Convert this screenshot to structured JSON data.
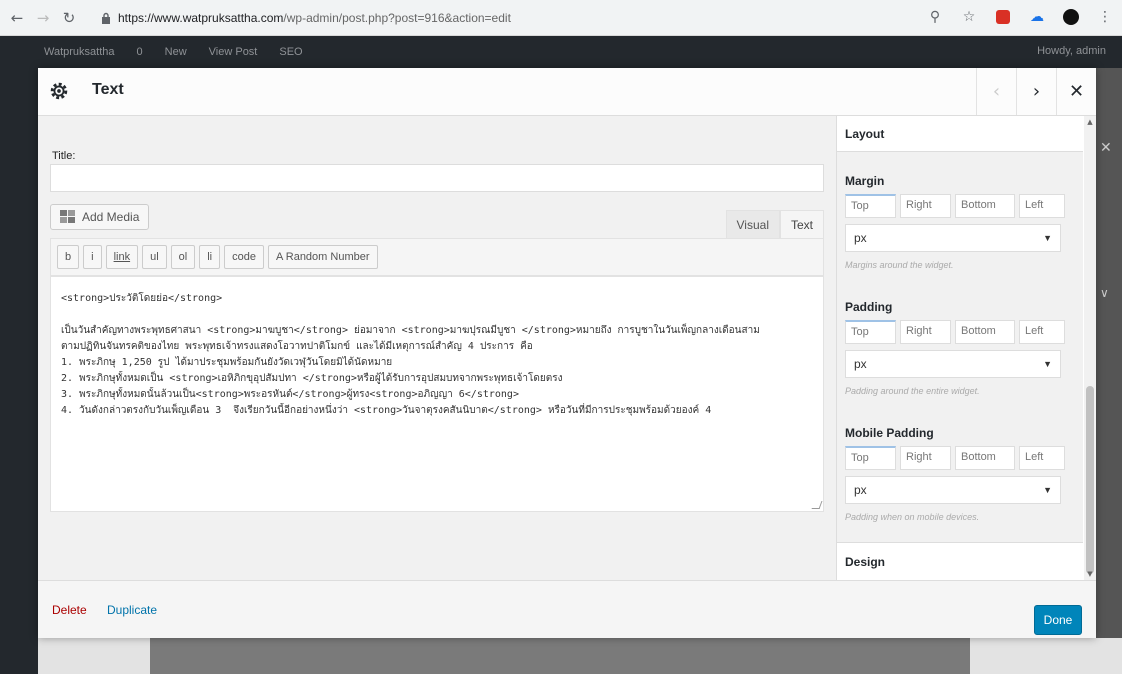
{
  "browser": {
    "url_host": "https://www.watpruksattha.com",
    "url_path": "/wp-admin/post.php?post=916&action=edit"
  },
  "adminbar": {
    "items": [
      "Watpruksattha",
      "0",
      "New",
      "View Post",
      "SEO"
    ],
    "howdy": "Howdy, admin"
  },
  "dialog": {
    "title": "Text",
    "title_label": "Title:",
    "title_value": "",
    "add_media": "Add Media",
    "tabs": [
      "Visual",
      "Text"
    ],
    "quicktags": [
      "b",
      "i",
      "link",
      "ul",
      "ol",
      "li",
      "code",
      "A Random Number"
    ],
    "editor_lines": [
      "<strong>ประวัติโดยย่อ</strong>",
      "",
      "เป็นวันสำคัญทางพระพุทธศาสนา <strong>มาฆบูชา</strong> ย่อมาจาก <strong>มาฆปุรณมีบูชา </strong>หมายถึง การบูชาในวันเพ็ญกลางเดือนสาม",
      "ตามปฏิทินจันทรคติของไทย พระพุทธเจ้าทรงแสดงโอวาทปาติโมกข์ และได้มีเหตุการณ์สำคัญ 4 ประการ คือ",
      "1. พระภิกษุ 1,250 รูป ได้มาประชุมพร้อมกันยังวัดเวฬุวันโดยมิได้นัดหมาย",
      "2. พระภิกษุทั้งหมดเป็น <strong>เอหิภิกขุอุปสัมปทา </strong>หรือผู้ได้รับการอุปสมบทจากพระพุทธเจ้าโดยตรง",
      "3. พระภิกษุทั้งหมดนั้นล้วนเป็น<strong>พระอรหันต์</strong>ผู้ทรง<strong>อภิญญา 6</strong>",
      "4. วันดังกล่าวตรงกับวันเพ็ญเดือน 3  จึงเรียกวันนี้อีกอย่างหนึ่งว่า <strong>วันจาตุรงคสันนิบาต</strong> หรือวันที่มีการประชุมพร้อมด้วยองค์ 4"
    ],
    "delete": "Delete",
    "duplicate": "Duplicate",
    "done": "Done"
  },
  "sidebar": {
    "layout": "Layout",
    "design": "Design",
    "margin": {
      "label": "Margin",
      "fields": [
        "Top",
        "Right",
        "Bottom",
        "Left"
      ],
      "unit": "px",
      "hint": "Margins around the widget."
    },
    "padding": {
      "label": "Padding",
      "fields": [
        "Top",
        "Right",
        "Bottom",
        "Left"
      ],
      "unit": "px",
      "hint": "Padding around the entire widget."
    },
    "mobile_padding": {
      "label": "Mobile Padding",
      "fields": [
        "Top",
        "Right",
        "Bottom",
        "Left"
      ],
      "unit": "px",
      "hint": "Padding when on mobile devices."
    }
  },
  "colors": {
    "primary_button": "#0085ba",
    "link": "#0073aa",
    "delete": "#aa0000",
    "admin_bar": "#23282d"
  },
  "icons": [
    "back-arrow-icon",
    "forward-arrow-icon",
    "reload-icon",
    "lock-icon",
    "zoom-icon",
    "star-icon",
    "gear-icon",
    "media-icon",
    "chevron-left-icon",
    "chevron-right-icon",
    "close-icon",
    "caret-down-icon"
  ]
}
